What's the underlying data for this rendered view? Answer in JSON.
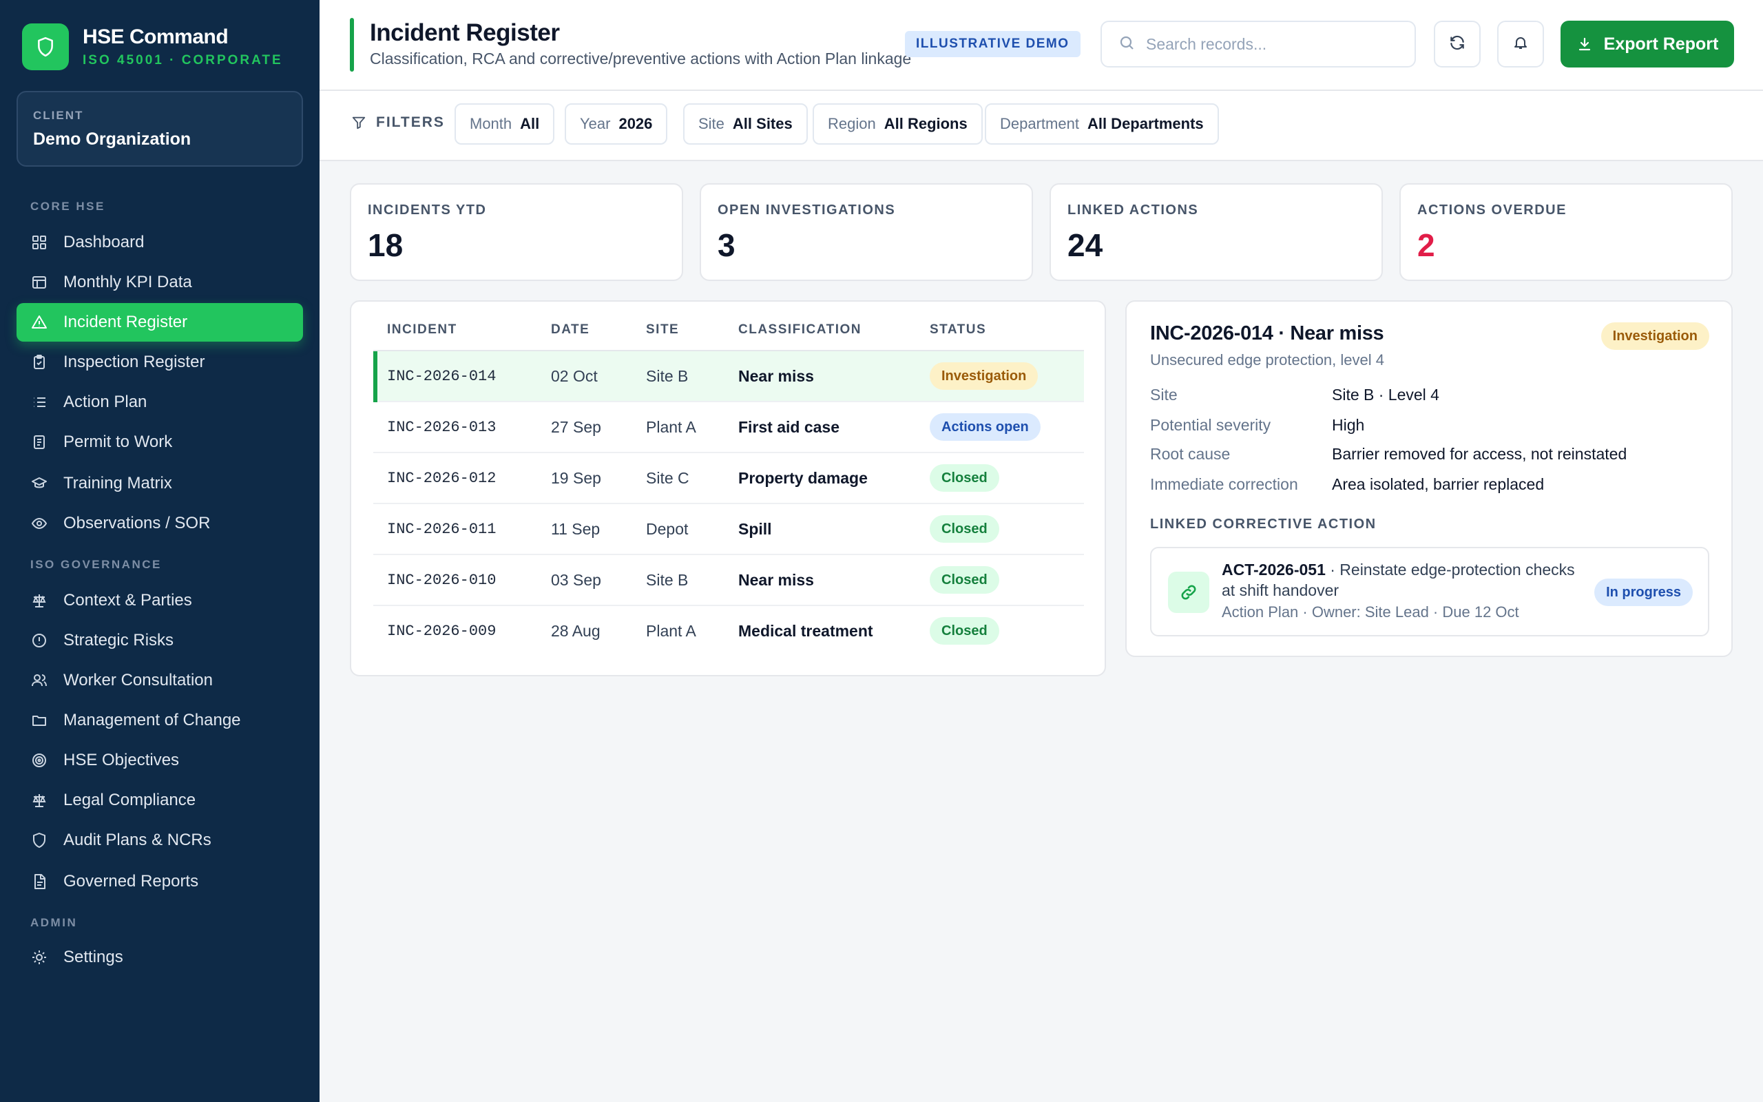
{
  "brand": {
    "title": "HSE Command",
    "subtitle": "ISO 45001 · CORPORATE"
  },
  "client": {
    "label": "CLIENT",
    "name": "Demo Organization"
  },
  "nav": {
    "sections": {
      "core": "CORE HSE",
      "iso": "ISO GOVERNANCE",
      "admin": "ADMIN"
    },
    "items": [
      {
        "label": "Dashboard",
        "icon": "grid-icon"
      },
      {
        "label": "Monthly KPI Data",
        "icon": "table-icon"
      },
      {
        "label": "Incident Register",
        "icon": "warning-icon",
        "active": true
      },
      {
        "label": "Inspection Register",
        "icon": "clipboard-check-icon"
      },
      {
        "label": "Action Plan",
        "icon": "list-icon"
      },
      {
        "label": "Permit to Work",
        "icon": "document-icon"
      },
      {
        "label": "Training Matrix",
        "icon": "graduation-cap-icon"
      },
      {
        "label": "Observations / SOR",
        "icon": "eye-icon"
      },
      {
        "label": "Context & Parties",
        "icon": "scale-icon"
      },
      {
        "label": "Strategic Risks",
        "icon": "alert-circle-icon"
      },
      {
        "label": "Worker Consultation",
        "icon": "users-icon"
      },
      {
        "label": "Management of Change",
        "icon": "folder-icon"
      },
      {
        "label": "HSE Objectives",
        "icon": "target-icon"
      },
      {
        "label": "Legal Compliance",
        "icon": "scale-icon"
      },
      {
        "label": "Audit Plans & NCRs",
        "icon": "shield-icon"
      },
      {
        "label": "Governed Reports",
        "icon": "file-text-icon"
      },
      {
        "label": "Settings",
        "icon": "sun-gear-icon"
      }
    ]
  },
  "header": {
    "title": "Incident Register",
    "subtitle": "Classification, RCA and corrective/preventive actions with Action Plan linkage",
    "badge": "ILLUSTRATIVE DEMO",
    "search_placeholder": "Search records...",
    "export_label": "Export Report"
  },
  "filters": {
    "label": "FILTERS",
    "chips": [
      {
        "key": "Month",
        "value": "All"
      },
      {
        "key": "Year",
        "value": "2026"
      },
      {
        "key": "Site",
        "value": "All Sites"
      },
      {
        "key": "Region",
        "value": "All Regions"
      },
      {
        "key": "Department",
        "value": "All Departments"
      }
    ]
  },
  "kpis": [
    {
      "label": "INCIDENTS YTD",
      "value": "18"
    },
    {
      "label": "OPEN INVESTIGATIONS",
      "value": "3"
    },
    {
      "label": "LINKED ACTIONS",
      "value": "24"
    },
    {
      "label": "ACTIONS OVERDUE",
      "value": "2",
      "color": "#e11d48"
    }
  ],
  "table": {
    "columns": [
      "INCIDENT",
      "DATE",
      "SITE",
      "CLASSIFICATION",
      "STATUS"
    ],
    "rows": [
      {
        "id": "INC-2026-014",
        "date": "02 Oct",
        "site": "Site B",
        "classification": "Near miss",
        "status": "Investigation",
        "kind": "investigation"
      },
      {
        "id": "INC-2026-013",
        "date": "27 Sep",
        "site": "Plant A",
        "classification": "First aid case",
        "status": "Actions open",
        "kind": "actions"
      },
      {
        "id": "INC-2026-012",
        "date": "19 Sep",
        "site": "Site C",
        "classification": "Property damage",
        "status": "Closed",
        "kind": "closed"
      },
      {
        "id": "INC-2026-011",
        "date": "11 Sep",
        "site": "Depot",
        "classification": "Spill",
        "status": "Closed",
        "kind": "closed"
      },
      {
        "id": "INC-2026-010",
        "date": "03 Sep",
        "site": "Site B",
        "classification": "Near miss",
        "status": "Closed",
        "kind": "closed"
      },
      {
        "id": "INC-2026-009",
        "date": "28 Aug",
        "site": "Plant A",
        "classification": "Medical treatment",
        "status": "Closed",
        "kind": "closed"
      }
    ]
  },
  "detail": {
    "title": "INC-2026-014 · Near miss",
    "status": "Investigation",
    "subtitle": "Unsecured edge protection, level 4",
    "fields": [
      {
        "label": "Site",
        "value": "Site B · Level 4"
      },
      {
        "label": "Potential severity",
        "value": "High"
      },
      {
        "label": "Root cause",
        "value": "Barrier removed for access, not reinstated"
      },
      {
        "label": "Immediate correction",
        "value": "Area isolated, barrier replaced"
      }
    ],
    "linked_label": "LINKED CORRECTIVE ACTION",
    "action": {
      "id": "ACT-2026-051",
      "description": " · Reinstate edge-protection checks at shift handover",
      "meta": "Action Plan · Owner: Site Lead · Due 12 Oct",
      "status": "In progress"
    }
  },
  "colors": {
    "sidebar": "#0e2a47",
    "accent": "#22c55e",
    "primary": "#15923f",
    "danger": "#e11d48"
  }
}
